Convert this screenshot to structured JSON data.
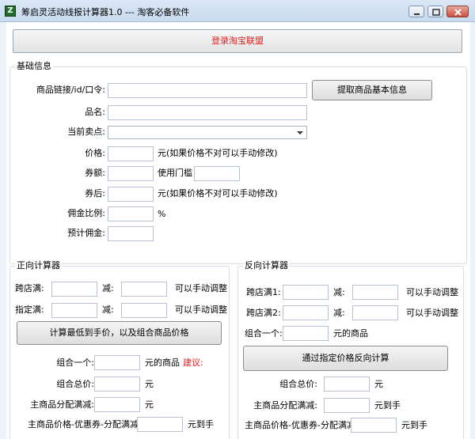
{
  "window": {
    "title": "筹启灵活动线报计算器1.0  ---  淘客必备软件",
    "icon": "app-logo-icon"
  },
  "login_button": "登录淘宝联盟",
  "basic_info": {
    "title": "基础信息",
    "link_label": "商品链接/id/口令:",
    "fetch_button": "提取商品基本信息",
    "name_label": "品名:",
    "selling_point_label": "当前卖点:",
    "price_label": "价格:",
    "price_hint": "元(如果价格不对可以手动修改)",
    "coupon_label": "券额:",
    "threshold_label": "使用门槛",
    "after_coupon_label": "券后:",
    "after_coupon_hint": "元(如果价格不对可以手动修改)",
    "commission_ratio_label": "佣金比例:",
    "percent": "%",
    "estimated_commission_label": "预计佣金:"
  },
  "forward_calc": {
    "title": "正向计算器",
    "cross_store_label": "跨店满:",
    "minus_label": "减:",
    "manual_hint": "可以手动调整",
    "designated_store_label": "指定满:",
    "calc_button": "计算最低到手价，以及组合商品价格",
    "combo_one_label": "组合一个:",
    "combo_unit": "元的商品",
    "suggest_label": "建议:",
    "combo_total_label": "组合总价:",
    "yuan": "元",
    "main_alloc_label": "主商品分配满减:",
    "main_final_label": "主商品价格-优惠券-分配满减=",
    "to_hand": "元到手"
  },
  "reverse_calc": {
    "title": "反向计算器",
    "cross_store1_label": "跨店满1:",
    "cross_store2_label": "跨店满2:",
    "minus_label": "减:",
    "manual_hint": "可以手动调整",
    "combo_one_label": "组合一个:",
    "combo_unit": "元的商品",
    "reverse_button": "通过指定价格反向计算",
    "combo_total_label": "组合总价:",
    "yuan": "元",
    "main_alloc_label": "主商品分配满减:",
    "yuan_to_hand": "元到手",
    "main_final_label": "主商品价格-优惠券-分配满减=",
    "to_hand": "元到手"
  }
}
